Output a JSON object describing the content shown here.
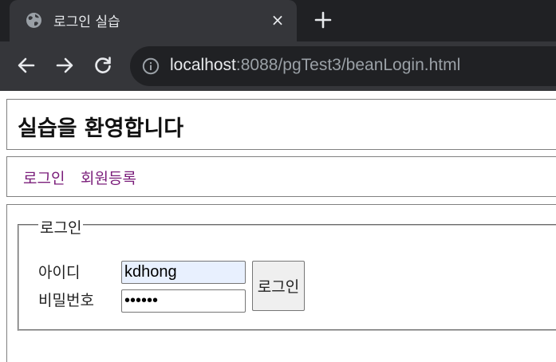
{
  "browser": {
    "tab": {
      "title": "로그인 실습",
      "close_glyph": "×"
    },
    "new_tab_glyph": "+",
    "address_bar": {
      "host": "localhost",
      "rest": ":8088/pgTest3/beanLogin.html"
    }
  },
  "page": {
    "title": "실습을 환영합니다",
    "menu": [
      {
        "label": "로그인"
      },
      {
        "label": "회원등록"
      }
    ],
    "login_form": {
      "legend": "로그인",
      "id_label": "아이디",
      "id_value": "kdhong",
      "password_label": "비밀번호",
      "password_value": "••••••",
      "submit_label": "로그인"
    }
  },
  "colors": {
    "chrome_dark": "#202124",
    "chrome_tab": "#35363a",
    "link": "#7a1d7a",
    "autofill": "#e8f0fe"
  },
  "icons": [
    "globe-icon",
    "close-icon",
    "plus-icon",
    "back-arrow-icon",
    "forward-arrow-icon",
    "reload-icon",
    "info-icon"
  ]
}
